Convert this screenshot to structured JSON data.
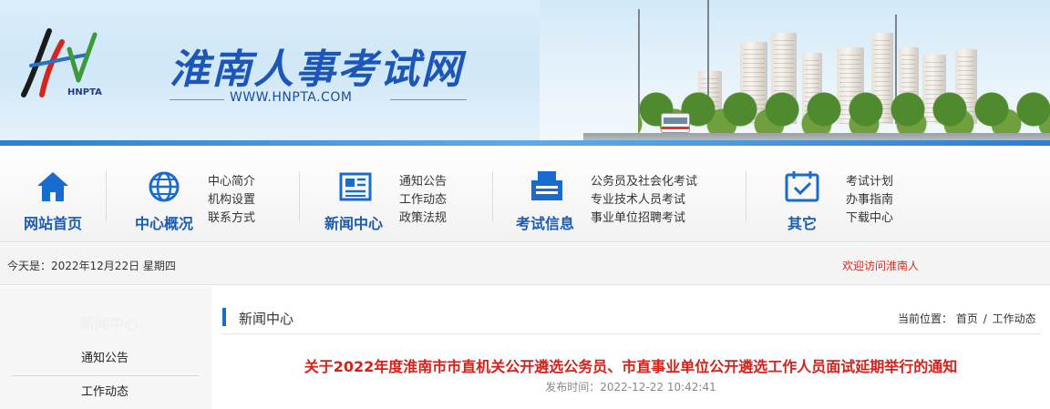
{
  "header": {
    "logo_text": "HNPTA",
    "site_title": "淮南人事考试网",
    "site_url": "WWW.HNPTA.COM"
  },
  "nav": [
    {
      "label": "网站首页",
      "icon": "home-icon",
      "links": []
    },
    {
      "label": "中心概况",
      "icon": "globe-icon",
      "links": [
        "中心简介",
        "机构设置",
        "联系方式"
      ]
    },
    {
      "label": "新闻中心",
      "icon": "newspaper-icon",
      "links": [
        "通知公告",
        "工作动态",
        "政策法规"
      ]
    },
    {
      "label": "考试信息",
      "icon": "exam-info-icon",
      "links": [
        "公务员及社会化考试",
        "专业技术人员考试",
        "事业单位招聘考试"
      ]
    },
    {
      "label": "其它",
      "icon": "calendar-check-icon",
      "links": [
        "考试计划",
        "办事指南",
        "下载中心"
      ]
    }
  ],
  "datebar": {
    "today": "今天是：2022年12月22日 星期四",
    "welcome": "欢迎访问淮南人"
  },
  "sidebar": {
    "heading": "新闻中心",
    "items": [
      "通知公告",
      "工作动态"
    ]
  },
  "content": {
    "section_title": "新闻中心",
    "breadcrumb_prefix": "当前位置：",
    "breadcrumb_home": "首页",
    "breadcrumb_sep": "/",
    "breadcrumb_current": "工作动态",
    "article_title": "关于2022年度淮南市市直机关公开遴选公务员、市直事业单位公开遴选工作人员面试延期举行的通知",
    "article_meta": "发布时间：2022-12-22 10:42:41"
  },
  "colors": {
    "brand_blue": "#1a5cb2",
    "title_red": "#d6201a",
    "welcome_red": "#d62b1f"
  }
}
